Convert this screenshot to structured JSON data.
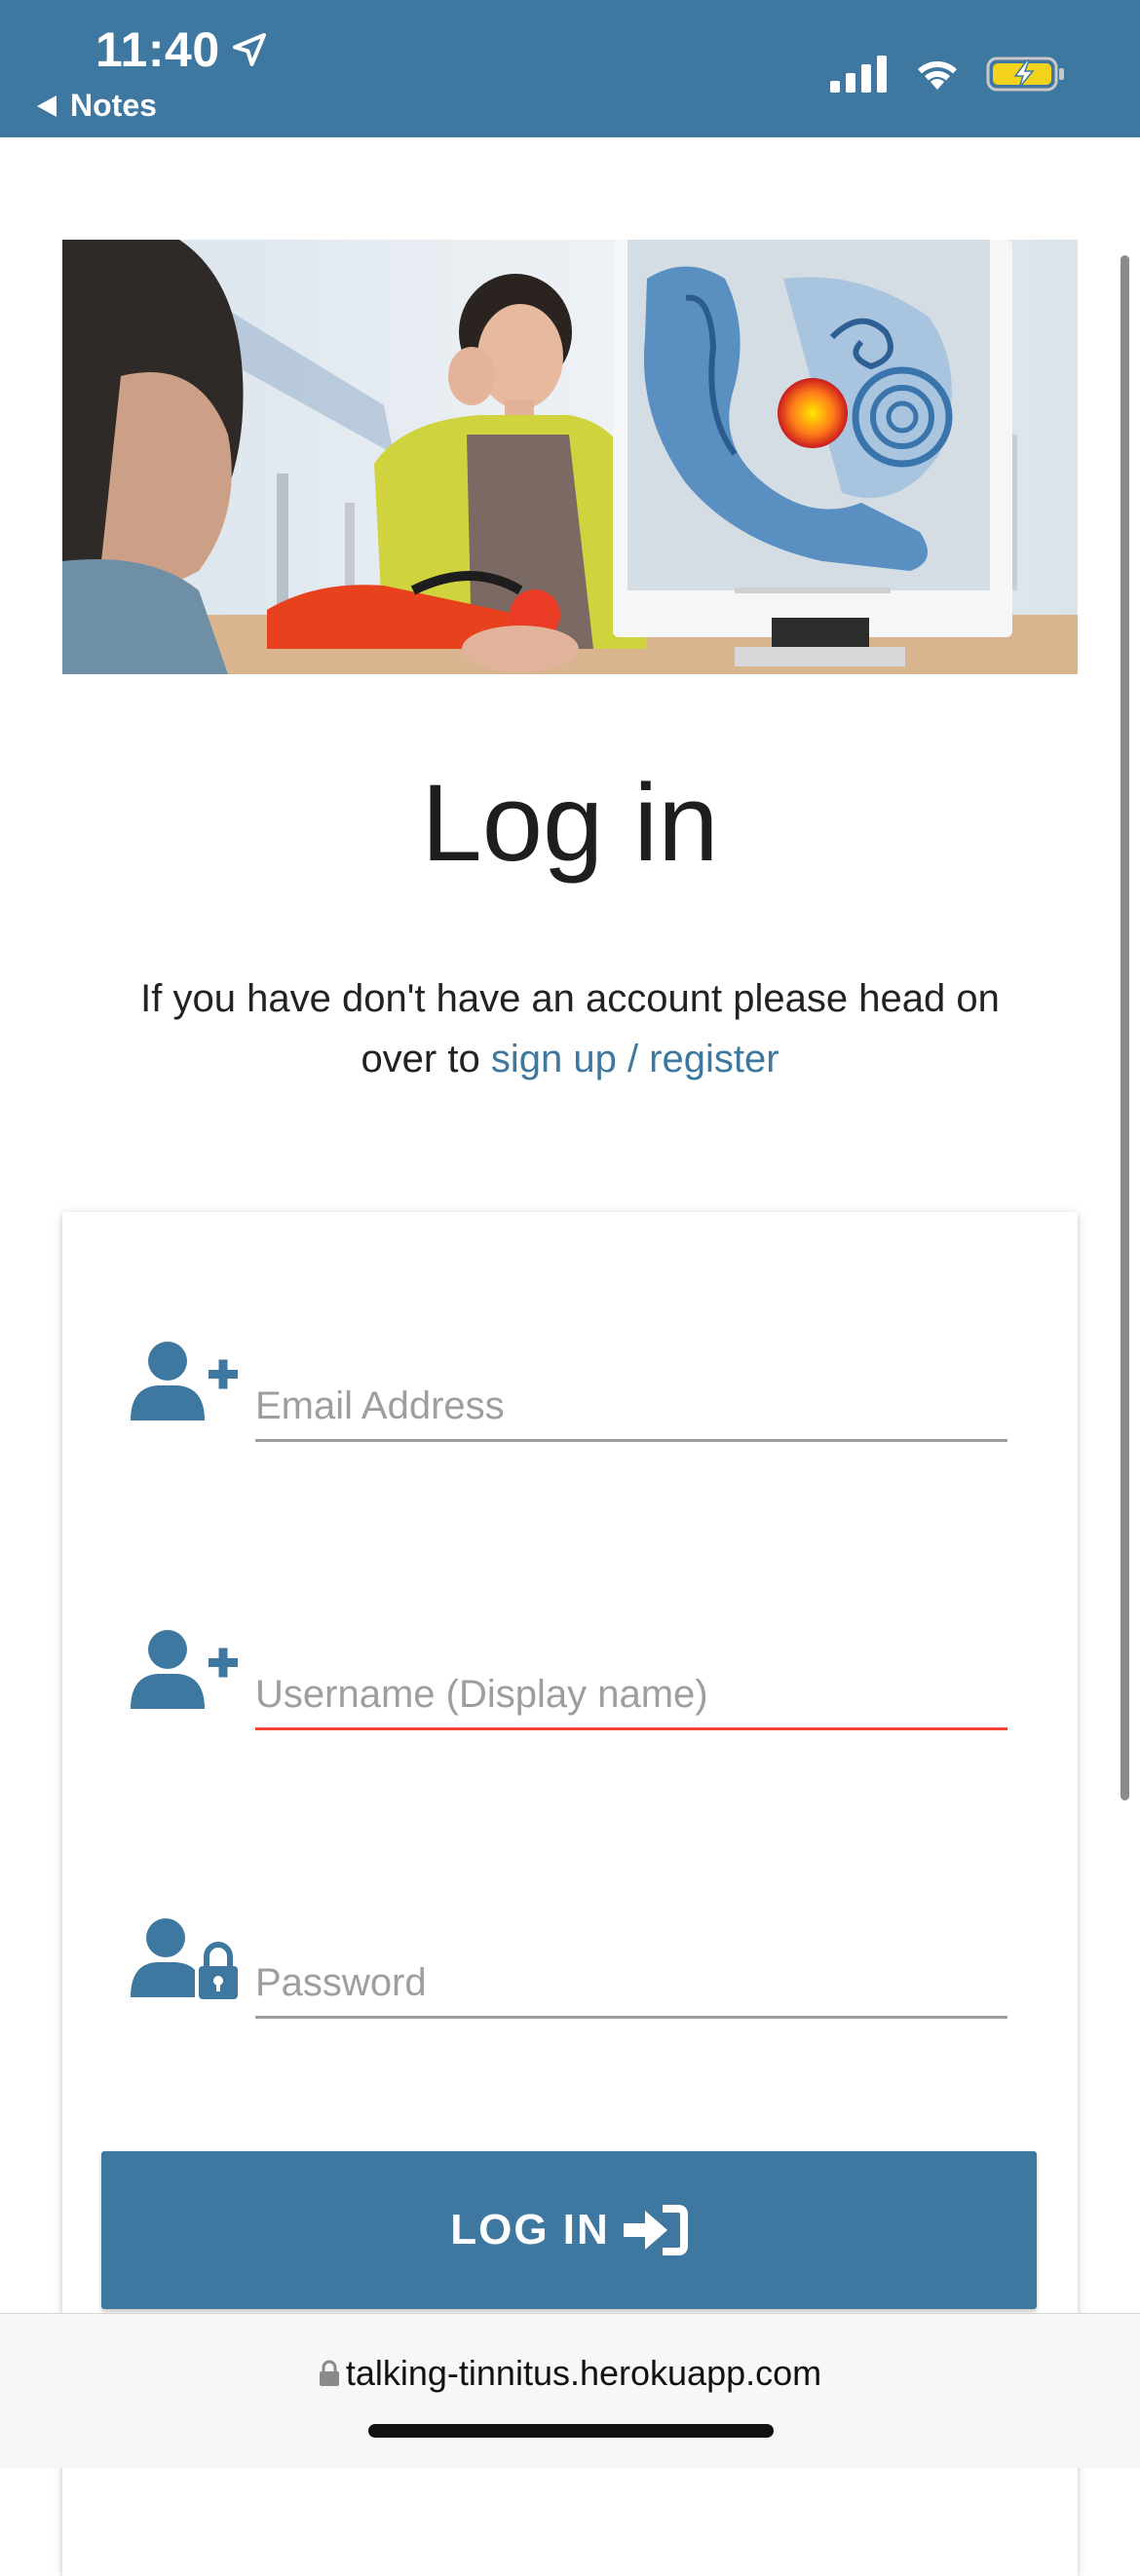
{
  "status_bar": {
    "time": "11:40",
    "back_label": "Notes",
    "background": "#3e78a0"
  },
  "hero": {
    "alt": "Doctor consulting a patient next to a monitor showing an ear anatomy diagram"
  },
  "page": {
    "title": "Log in",
    "intro_text": "If you have don't have an account please head on over to",
    "signup_link": "sign up / register",
    "accent_color": "#3e78a0"
  },
  "form": {
    "email_placeholder": "Email Address",
    "username_placeholder": "Username (Display name)",
    "password_placeholder": "Password",
    "submit_label": "LOG IN"
  },
  "browser": {
    "url": "talking-tinnitus.herokuapp.com"
  },
  "icons": {
    "location": "location-arrow-icon",
    "back": "back-triangle-icon",
    "signal": "cellular-signal-icon",
    "wifi": "wifi-icon",
    "battery": "battery-charging-icon",
    "email_field": "user-plus-icon",
    "username_field": "user-plus-icon",
    "password_field": "user-lock-icon",
    "submit": "sign-in-icon",
    "url_lock": "lock-icon"
  }
}
